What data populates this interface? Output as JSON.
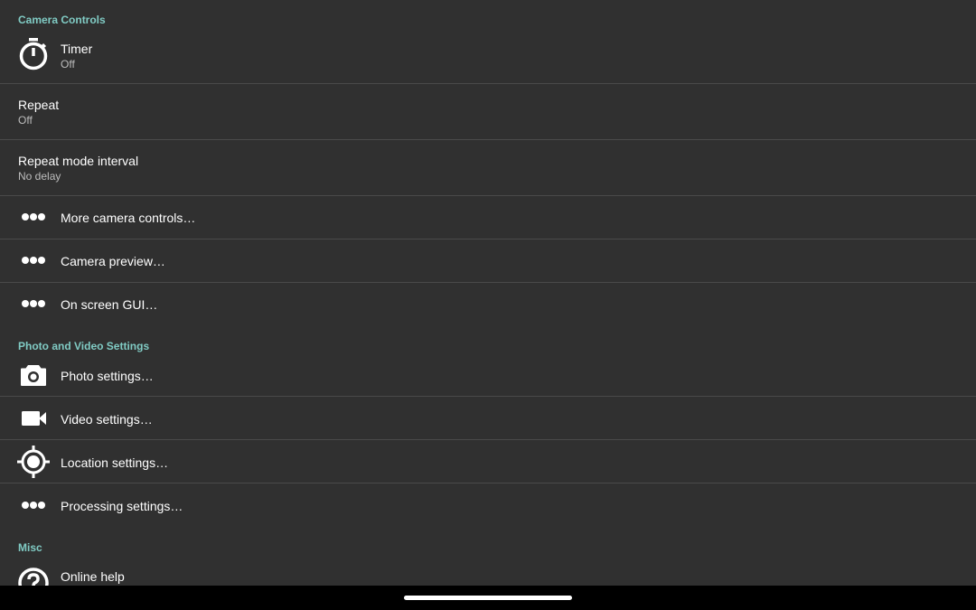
{
  "sections": {
    "camera_controls": "Camera Controls",
    "photo_video": "Photo and Video Settings",
    "misc": "Misc"
  },
  "items": {
    "timer": {
      "title": "Timer",
      "summary": "Off",
      "icon": "timer-icon"
    },
    "repeat": {
      "title": "Repeat",
      "summary": "Off"
    },
    "repeat_interval": {
      "title": "Repeat mode interval",
      "summary": "No delay"
    },
    "more_camera_controls": {
      "title": "More camera controls…",
      "icon": "more-dots-icon"
    },
    "camera_preview": {
      "title": "Camera preview…",
      "icon": "more-dots-icon"
    },
    "on_screen_gui": {
      "title": "On screen GUI…",
      "icon": "more-dots-icon"
    },
    "photo_settings": {
      "title": "Photo settings…",
      "icon": "camera-icon"
    },
    "video_settings": {
      "title": "Video settings…",
      "icon": "videocam-icon"
    },
    "location_settings": {
      "title": "Location settings…",
      "icon": "gps-location-icon"
    },
    "processing_settings": {
      "title": "Processing settings…",
      "icon": "more-dots-icon"
    },
    "online_help": {
      "title": "Online help",
      "icon": "help-icon"
    }
  },
  "colors": {
    "background": "#303030",
    "accent": "#80cbc4",
    "divider": "#4a4a4a",
    "navbar": "#000000"
  }
}
